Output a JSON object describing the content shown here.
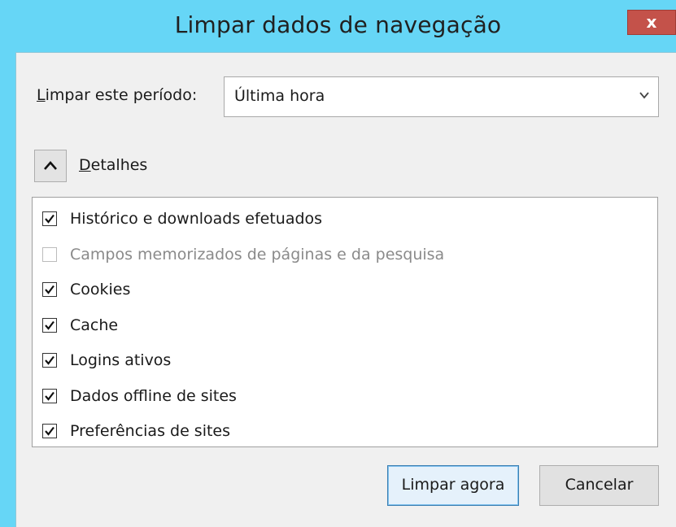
{
  "window": {
    "title": "Limpar dados de navegação",
    "close_label": "x",
    "colors": {
      "titlebar": "#66d6f6",
      "close": "#c4524a",
      "client": "#f0f0f0"
    }
  },
  "period": {
    "label_mnemonic": "L",
    "label_rest": "impar este período:",
    "value": "Última hora",
    "dropdown_icon": "chevron-down-icon"
  },
  "details": {
    "toggle_icon": "chevron-up-icon",
    "label_mnemonic": "D",
    "label_rest": "etalhes",
    "expanded": true
  },
  "items": [
    {
      "label": "Histórico e downloads efetuados",
      "checked": true,
      "disabled": false
    },
    {
      "label": "Campos memorizados de páginas e da pesquisa",
      "checked": false,
      "disabled": true
    },
    {
      "label": "Cookies",
      "checked": true,
      "disabled": false
    },
    {
      "label": "Cache",
      "checked": true,
      "disabled": false
    },
    {
      "label": "Logins ativos",
      "checked": true,
      "disabled": false
    },
    {
      "label": "Dados offline de sites",
      "checked": true,
      "disabled": false
    },
    {
      "label": "Preferências de sites",
      "checked": true,
      "disabled": false
    }
  ],
  "buttons": {
    "clear_now": "Limpar agora",
    "cancel": "Cancelar"
  }
}
